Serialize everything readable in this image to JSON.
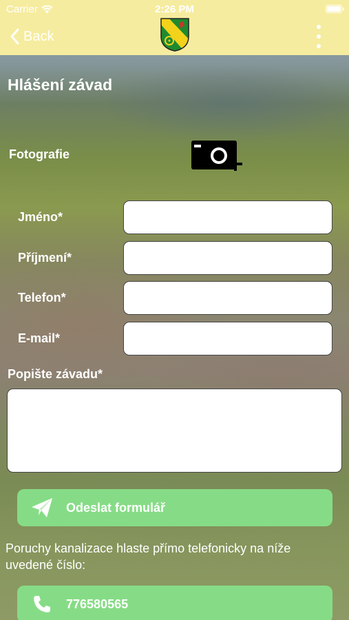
{
  "status_bar": {
    "carrier": "Carrier",
    "time": "2:26 PM"
  },
  "nav": {
    "back_label": "Back"
  },
  "page": {
    "title": "Hlášení závad"
  },
  "form": {
    "photo_label": "Fotografie",
    "fields": [
      {
        "label": "Jméno*",
        "value": "",
        "placeholder": ""
      },
      {
        "label": "Příjmení*",
        "value": "",
        "placeholder": ""
      },
      {
        "label": "Telefon*",
        "value": "",
        "placeholder": ""
      },
      {
        "label": "E-mail*",
        "value": "",
        "placeholder": ""
      }
    ],
    "description_label": "Popište závadu*",
    "description_value": "",
    "submit_label": "Odeslat formulář"
  },
  "info": {
    "text": "Poruchy kanalizace hlaste přímo telefonicky na níže uvedené číslo:",
    "phone": "776580565"
  },
  "colors": {
    "header_bg": "#f6ec9f",
    "button_green": "#86dc86",
    "crest_green": "#1f8a2e",
    "crest_yellow": "#f2d21a"
  },
  "icons": [
    "wifi-icon",
    "battery-icon",
    "back-chevron-icon",
    "municipal-crest-logo",
    "more-vertical-icon",
    "add-photo-camera-icon",
    "send-paper-plane-icon",
    "phone-icon"
  ]
}
